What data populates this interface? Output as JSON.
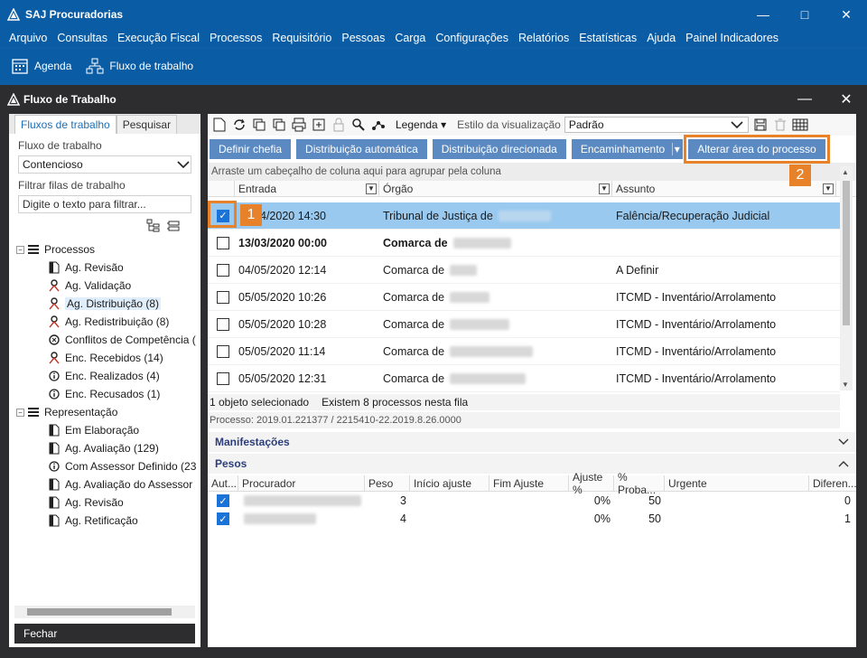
{
  "window": {
    "title": "SAJ Procuradorias"
  },
  "menu": [
    "Arquivo",
    "Consultas",
    "Execução Fiscal",
    "Processos",
    "Requisitório",
    "Pessoas",
    "Carga",
    "Configurações",
    "Relatórios",
    "Estatísticas",
    "Ajuda",
    "Painel Indicadores"
  ],
  "quick": {
    "agenda": "Agenda",
    "fluxo": "Fluxo de trabalho"
  },
  "inner": {
    "title": "Fluxo de Trabalho"
  },
  "left": {
    "tab_fluxos": "Fluxos de trabalho",
    "tab_pesquisar": "Pesquisar",
    "fluxo_label": "Fluxo de trabalho",
    "fluxo_value": "Contencioso",
    "filtrar_label": "Filtrar filas de trabalho",
    "filtrar_placeholder": "Digite o texto para filtrar...",
    "fechar": "Fechar"
  },
  "tree": {
    "processos": "Processos",
    "p_items": [
      "Ag. Revisão",
      "Ag. Validação",
      "Ag. Distribuição (8)",
      "Ag. Redistribuição (8)",
      "Conflitos de Competência (",
      "Enc. Recebidos (14)",
      "Enc. Realizados (4)",
      "Enc. Recusados (1)"
    ],
    "representacao": "Representação",
    "r_items": [
      "Em Elaboração",
      "Ag. Avaliação (129)",
      "Com Assessor Definido (23",
      "Ag. Avaliação do Assessor",
      "Ag. Revisão",
      "Ag. Retificação"
    ]
  },
  "toolbar": {
    "legenda": "Legenda",
    "estilo_label": "Estilo da visualização",
    "estilo_value": "Padrão"
  },
  "buttons": {
    "definir": "Definir chefia",
    "automatica": "Distribuição automática",
    "direcionada": "Distribuição direcionada",
    "encaminhamento": "Encaminhamento",
    "alterar": "Alterar área do processo"
  },
  "badges": {
    "one": "1",
    "two": "2"
  },
  "grid": {
    "hint": "Arraste um cabeçalho de coluna aqui para agrupar pela coluna",
    "cols": [
      "Entrada",
      "Órgão",
      "Assunto"
    ],
    "rows": [
      {
        "entrada": "4/2020 14:30",
        "orgao": "Tribunal de Justiça de",
        "assunto": "Falência/Recuperação Judicial"
      },
      {
        "entrada": "13/03/2020 00:00",
        "orgao": "Comarca de",
        "assunto": ""
      },
      {
        "entrada": "04/05/2020 12:14",
        "orgao": "Comarca de",
        "assunto": "A Definir"
      },
      {
        "entrada": "05/05/2020 10:26",
        "orgao": "Comarca de",
        "assunto": "ITCMD - Inventário/Arrolamento"
      },
      {
        "entrada": "05/05/2020 10:28",
        "orgao": "Comarca de",
        "assunto": "ITCMD - Inventário/Arrolamento"
      },
      {
        "entrada": "05/05/2020 11:14",
        "orgao": "Comarca de",
        "assunto": "ITCMD - Inventário/Arrolamento"
      },
      {
        "entrada": "05/05/2020 12:31",
        "orgao": "Comarca de",
        "assunto": "ITCMD - Inventário/Arrolamento"
      }
    ]
  },
  "status": {
    "selecionado": "1 objeto selecionado",
    "existem": "Existem 8 processos nesta fila",
    "processo": "Processo: 2019.01.221377 / 2215410-22.2019.8.26.0000"
  },
  "sections": {
    "manifestacoes": "Manifestações",
    "pesos": "Pesos"
  },
  "pesos": {
    "cols": [
      "Aut...",
      "Procurador",
      "Peso",
      "Início ajuste",
      "Fim Ajuste",
      "Ajuste %",
      "% Proba...",
      "Urgente",
      "Diferen..."
    ],
    "rows": [
      {
        "peso": "3",
        "ajuste": "0%",
        "prob": "50",
        "dif": "0"
      },
      {
        "peso": "4",
        "ajuste": "0%",
        "prob": "50",
        "dif": "1"
      }
    ]
  },
  "colors": {
    "accent": "#0a5da5",
    "button": "#5b8ac2",
    "highlight": "#e8822a",
    "selection": "#99c9ef"
  }
}
